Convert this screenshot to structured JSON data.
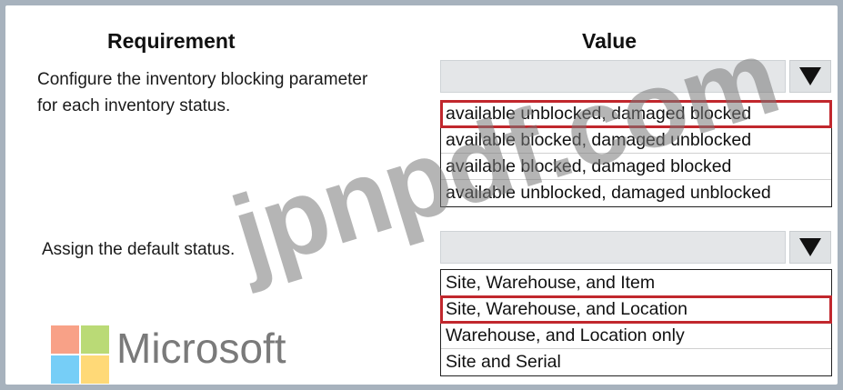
{
  "headers": {
    "requirement": "Requirement",
    "value": "Value"
  },
  "rows": [
    {
      "requirement_lines": [
        "Configure the inventory blocking parameter",
        "for each inventory status."
      ],
      "options": [
        "available unblocked, damaged blocked",
        "available blocked, damaged unblocked",
        "available blocked, damaged blocked",
        "available unblocked, damaged unblocked"
      ],
      "selected_index": 0
    },
    {
      "requirement_lines": [
        "Assign the default status."
      ],
      "options": [
        "Site, Warehouse, and Item",
        "Site, Warehouse, and Location",
        "Warehouse, and Location only",
        "Site and Serial"
      ],
      "selected_index": 1
    }
  ],
  "watermark": "jpnpdf.com",
  "logo": {
    "text": "Microsoft",
    "colors": [
      "#f35325",
      "#81bc06",
      "#05a6f0",
      "#ffba08"
    ]
  },
  "selection_color": "#c1272d"
}
